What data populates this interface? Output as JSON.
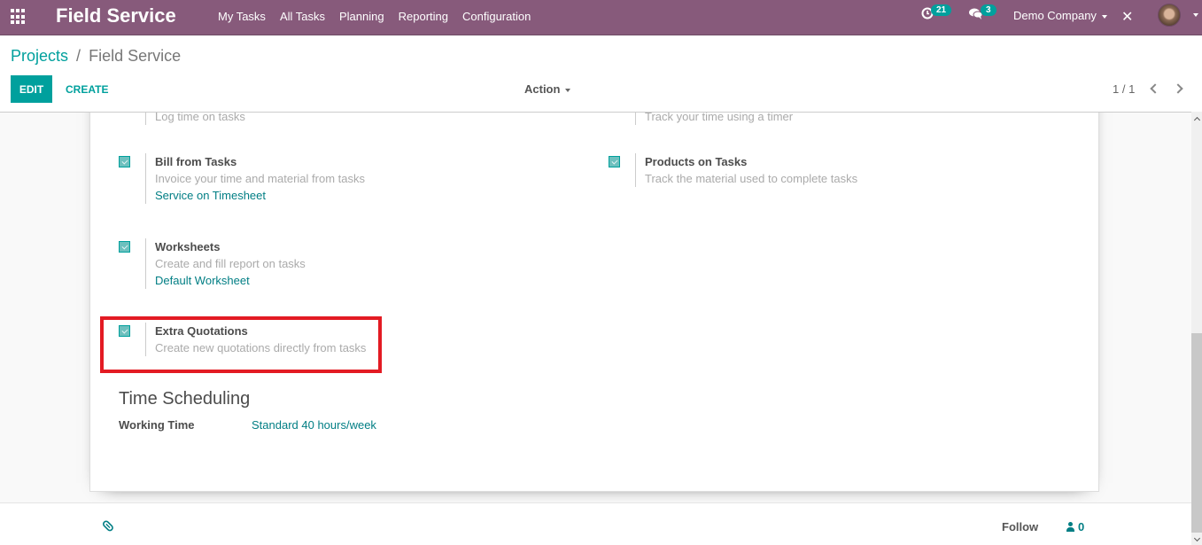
{
  "navbar": {
    "brand": "Field Service",
    "menu": [
      "My Tasks",
      "All Tasks",
      "Planning",
      "Reporting",
      "Configuration"
    ],
    "activity_count": "21",
    "message_count": "3",
    "company": "Demo Company"
  },
  "breadcrumb": {
    "parent": "Projects",
    "separator": "/",
    "current": "Field Service"
  },
  "control_panel": {
    "edit_label": "EDIT",
    "create_label": "CREATE",
    "action_label": "Action",
    "pager": "1 / 1"
  },
  "settings": {
    "partial_left": {
      "description": "Log time on tasks"
    },
    "partial_right": {
      "description": "Track your time using a timer"
    },
    "items": [
      {
        "title": "Bill from Tasks",
        "description": "Invoice your time and material from tasks",
        "link": "Service on Timesheet",
        "checked": true
      },
      {
        "title": "Products on Tasks",
        "description": "Track the material used to complete tasks",
        "checked": true
      },
      {
        "title": "Worksheets",
        "description": "Create and fill report on tasks",
        "link": "Default Worksheet",
        "checked": true
      },
      {
        "title": "Extra Quotations",
        "description": "Create new quotations directly from tasks",
        "checked": true
      }
    ]
  },
  "time_scheduling": {
    "title": "Time Scheduling",
    "working_time_label": "Working Time",
    "working_time_value": "Standard 40 hours/week"
  },
  "chatter": {
    "follow_label": "Follow",
    "followers_count": "0"
  },
  "colors": {
    "navbar": "#875a7b",
    "accent": "#00a09d",
    "link": "#017e84",
    "highlight": "#e31b23"
  }
}
